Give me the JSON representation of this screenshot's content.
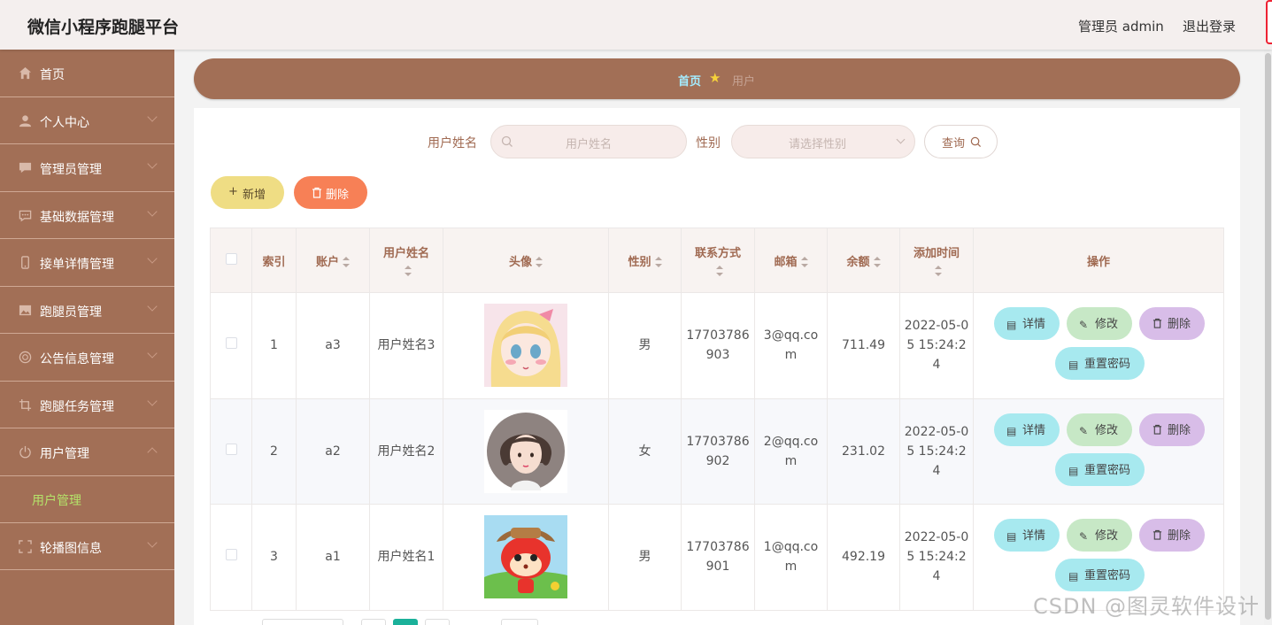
{
  "header": {
    "title": "微信小程序跑腿平台",
    "admin": "管理员 admin",
    "logout": "退出登录"
  },
  "sidebar": {
    "items": [
      {
        "label": "首页",
        "icon": "home-icon"
      },
      {
        "label": "个人中心",
        "icon": "user-icon"
      },
      {
        "label": "管理员管理",
        "icon": "chat-icon"
      },
      {
        "label": "基础数据管理",
        "icon": "message-icon"
      },
      {
        "label": "接单详情管理",
        "icon": "phone-icon"
      },
      {
        "label": "跑腿员管理",
        "icon": "picture-icon"
      },
      {
        "label": "公告信息管理",
        "icon": "globe-icon"
      },
      {
        "label": "跑腿任务管理",
        "icon": "crop-icon"
      },
      {
        "label": "用户管理",
        "icon": "power-icon"
      },
      {
        "label": "轮播图信息",
        "icon": "expand-icon"
      }
    ],
    "submenu_active": "用户管理"
  },
  "breadcrumb": {
    "home": "首页",
    "current": "用户"
  },
  "search": {
    "name_label": "用户姓名",
    "name_placeholder": "用户姓名",
    "gender_label": "性别",
    "gender_placeholder": "请选择性别",
    "query_button": "查询"
  },
  "actions": {
    "add": "新增",
    "delete": "删除"
  },
  "table": {
    "headers": {
      "index": "索引",
      "account": "账户",
      "name": "用户姓名",
      "avatar": "头像",
      "gender": "性别",
      "phone": "联系方式",
      "email": "邮箱",
      "balance": "余额",
      "added": "添加时间",
      "ops": "操作"
    },
    "rows": [
      {
        "index": "1",
        "account": "a3",
        "name": "用户姓名3",
        "gender": "男",
        "phone": "17703786903",
        "email": "3@qq.com",
        "balance": "711.49",
        "added": "2022-05-05 15:24:24",
        "avatar": "anime-girl-blonde"
      },
      {
        "index": "2",
        "account": "a2",
        "name": "用户姓名2",
        "gender": "女",
        "phone": "17703786902",
        "email": "2@qq.com",
        "balance": "231.02",
        "added": "2022-05-05 15:24:24",
        "avatar": "illustrated-woman"
      },
      {
        "index": "3",
        "account": "a1",
        "name": "用户姓名1",
        "gender": "男",
        "phone": "17703786901",
        "email": "1@qq.com",
        "balance": "492.19",
        "added": "2022-05-05 15:24:24",
        "avatar": "cartoon-fox"
      }
    ],
    "op_labels": {
      "detail": "详情",
      "edit": "修改",
      "delete": "删除",
      "reset": "重置密码"
    }
  },
  "watermark": "CSDN @图灵软件设计"
}
